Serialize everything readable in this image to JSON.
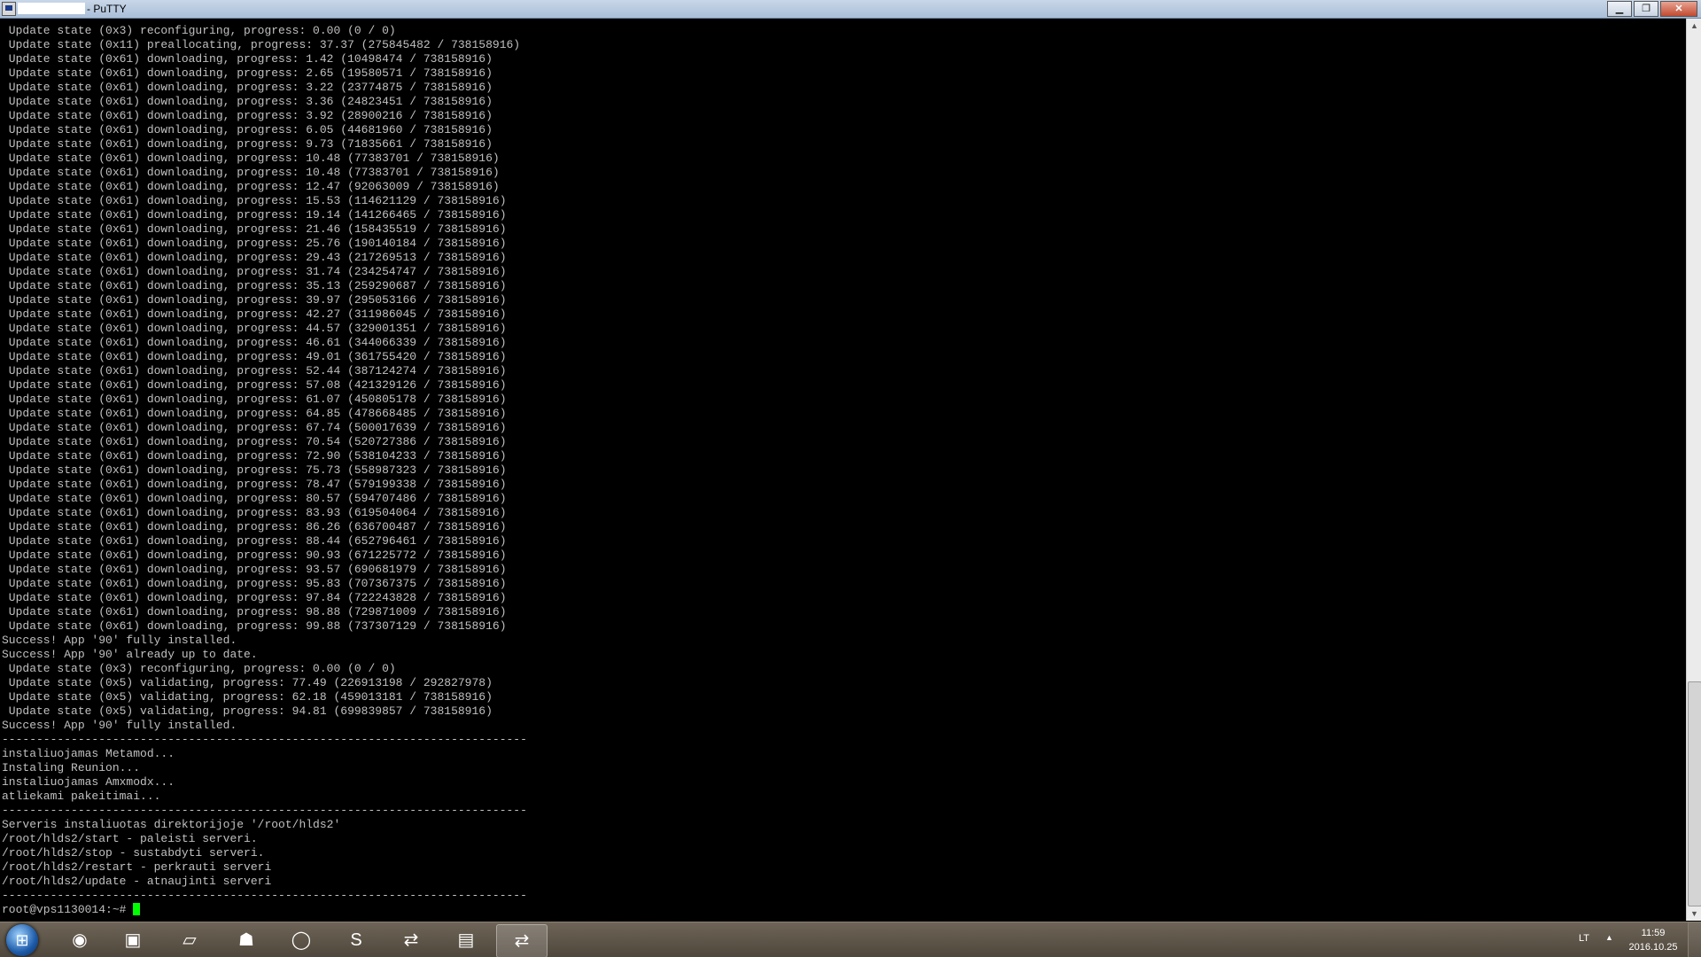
{
  "window": {
    "title": "- PuTTY",
    "buttons": {
      "minimize": "▁",
      "maximize": "❐",
      "close": "✕"
    }
  },
  "terminal": {
    "lines": [
      " Update state (0x3) reconfiguring, progress: 0.00 (0 / 0)",
      " Update state (0x11) preallocating, progress: 37.37 (275845482 / 738158916)",
      " Update state (0x61) downloading, progress: 1.42 (10498474 / 738158916)",
      " Update state (0x61) downloading, progress: 2.65 (19580571 / 738158916)",
      " Update state (0x61) downloading, progress: 3.22 (23774875 / 738158916)",
      " Update state (0x61) downloading, progress: 3.36 (24823451 / 738158916)",
      " Update state (0x61) downloading, progress: 3.92 (28900216 / 738158916)",
      " Update state (0x61) downloading, progress: 6.05 (44681960 / 738158916)",
      " Update state (0x61) downloading, progress: 9.73 (71835661 / 738158916)",
      " Update state (0x61) downloading, progress: 10.48 (77383701 / 738158916)",
      " Update state (0x61) downloading, progress: 10.48 (77383701 / 738158916)",
      " Update state (0x61) downloading, progress: 12.47 (92063009 / 738158916)",
      " Update state (0x61) downloading, progress: 15.53 (114621129 / 738158916)",
      " Update state (0x61) downloading, progress: 19.14 (141266465 / 738158916)",
      " Update state (0x61) downloading, progress: 21.46 (158435519 / 738158916)",
      " Update state (0x61) downloading, progress: 25.76 (190140184 / 738158916)",
      " Update state (0x61) downloading, progress: 29.43 (217269513 / 738158916)",
      " Update state (0x61) downloading, progress: 31.74 (234254747 / 738158916)",
      " Update state (0x61) downloading, progress: 35.13 (259290687 / 738158916)",
      " Update state (0x61) downloading, progress: 39.97 (295053166 / 738158916)",
      " Update state (0x61) downloading, progress: 42.27 (311986045 / 738158916)",
      " Update state (0x61) downloading, progress: 44.57 (329001351 / 738158916)",
      " Update state (0x61) downloading, progress: 46.61 (344066339 / 738158916)",
      " Update state (0x61) downloading, progress: 49.01 (361755420 / 738158916)",
      " Update state (0x61) downloading, progress: 52.44 (387124274 / 738158916)",
      " Update state (0x61) downloading, progress: 57.08 (421329126 / 738158916)",
      " Update state (0x61) downloading, progress: 61.07 (450805178 / 738158916)",
      " Update state (0x61) downloading, progress: 64.85 (478668485 / 738158916)",
      " Update state (0x61) downloading, progress: 67.74 (500017639 / 738158916)",
      " Update state (0x61) downloading, progress: 70.54 (520727386 / 738158916)",
      " Update state (0x61) downloading, progress: 72.90 (538104233 / 738158916)",
      " Update state (0x61) downloading, progress: 75.73 (558987323 / 738158916)",
      " Update state (0x61) downloading, progress: 78.47 (579199338 / 738158916)",
      " Update state (0x61) downloading, progress: 80.57 (594707486 / 738158916)",
      " Update state (0x61) downloading, progress: 83.93 (619504064 / 738158916)",
      " Update state (0x61) downloading, progress: 86.26 (636700487 / 738158916)",
      " Update state (0x61) downloading, progress: 88.44 (652796461 / 738158916)",
      " Update state (0x61) downloading, progress: 90.93 (671225772 / 738158916)",
      " Update state (0x61) downloading, progress: 93.57 (690681979 / 738158916)",
      " Update state (0x61) downloading, progress: 95.83 (707367375 / 738158916)",
      " Update state (0x61) downloading, progress: 97.84 (722243828 / 738158916)",
      " Update state (0x61) downloading, progress: 98.88 (729871009 / 738158916)",
      " Update state (0x61) downloading, progress: 99.88 (737307129 / 738158916)",
      "Success! App '90' fully installed.",
      "Success! App '90' already up to date.",
      " Update state (0x3) reconfiguring, progress: 0.00 (0 / 0)",
      " Update state (0x5) validating, progress: 77.49 (226913198 / 292827978)",
      " Update state (0x5) validating, progress: 62.18 (459013181 / 738158916)",
      " Update state (0x5) validating, progress: 94.81 (699839857 / 738158916)",
      "Success! App '90' fully installed.",
      "----------------------------------------------------------------------------",
      "instaliuojamas Metamod...",
      "Instaling Reunion...",
      "instaliuojamas Amxmodx...",
      "atliekami pakeitimai...",
      "----------------------------------------------------------------------------",
      "Serveris instaliuotas direktorijoje '/root/hlds2'",
      "/root/hlds2/start - paleisti serveri.",
      "/root/hlds2/stop - sustabdyti serveri.",
      "/root/hlds2/restart - perkrauti serveri",
      "/root/hlds2/update - atnaujinti serveri",
      "----------------------------------------------------------------------------"
    ],
    "prompt": "root@vps1130014:~# ",
    "cursor_color": "#00ff00",
    "text_color": "#c0c0c0",
    "background": "#000000"
  },
  "taskbar": {
    "items": [
      {
        "name": "media-player-icon",
        "glyph": "◉",
        "active": false
      },
      {
        "name": "network-manager-icon",
        "glyph": "▣",
        "active": false
      },
      {
        "name": "notepad-icon",
        "glyph": "▱",
        "active": false
      },
      {
        "name": "game-app-icon",
        "glyph": "☗",
        "active": false
      },
      {
        "name": "opera-browser-icon",
        "glyph": "◯",
        "active": false
      },
      {
        "name": "skype-icon",
        "glyph": "S",
        "active": false
      },
      {
        "name": "putty-icon",
        "glyph": "⇄",
        "active": false
      },
      {
        "name": "file-explorer-icon",
        "glyph": "▤",
        "active": false
      },
      {
        "name": "putty-active-icon",
        "glyph": "⇄",
        "active": true
      }
    ],
    "language": "LT",
    "tray_arrow": "▲",
    "time": "11:59",
    "date": "2016.10.25"
  },
  "scrollbar": {
    "up": "▲",
    "down": "▼"
  }
}
